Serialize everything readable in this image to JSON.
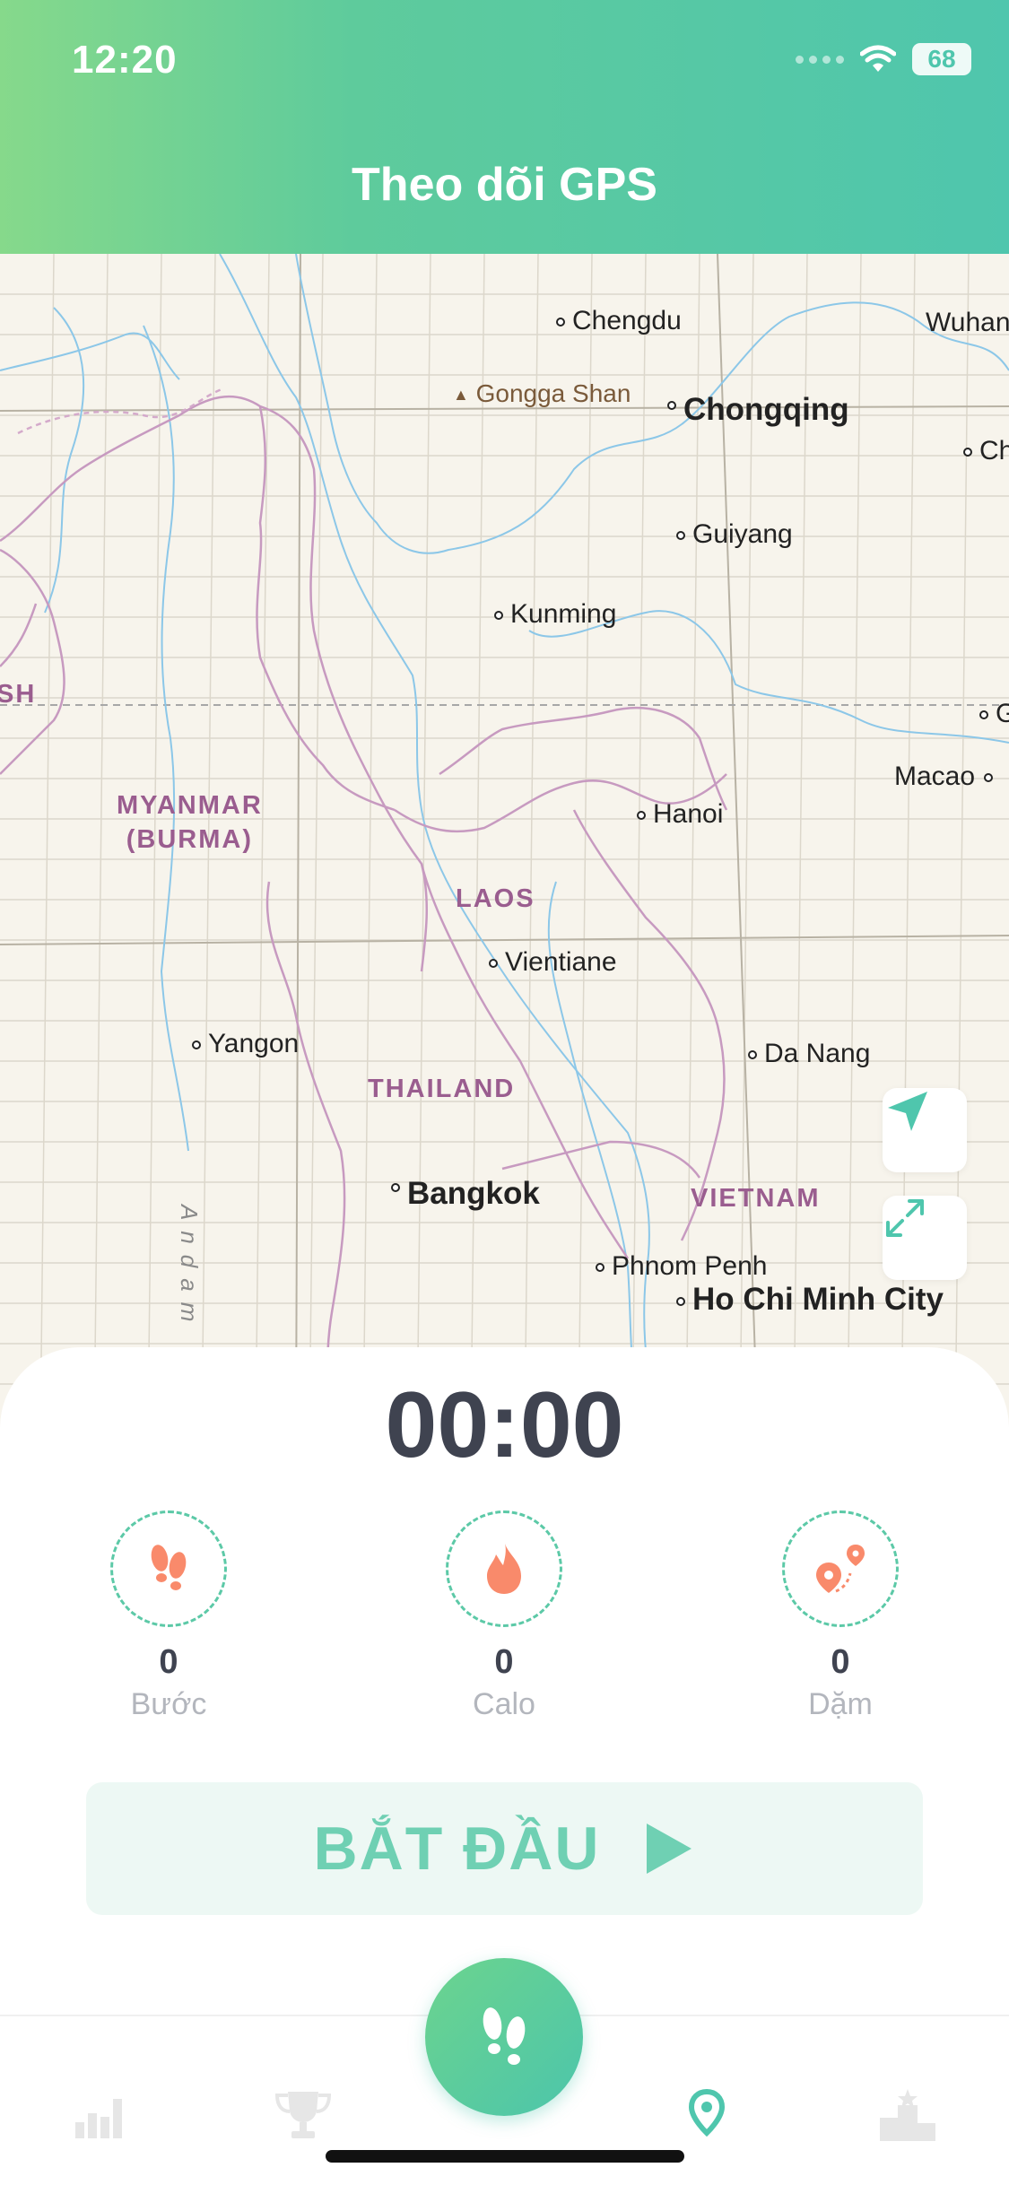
{
  "status_bar": {
    "time": "12:20",
    "battery": "68"
  },
  "header": {
    "title": "Theo dõi GPS"
  },
  "map": {
    "cities": {
      "chengdu": "Chengdu",
      "wuhan": "Wuhan",
      "chongqing": "Chongqing",
      "ch": "Ch",
      "guiyang": "Guiyang",
      "kunming": "Kunming",
      "hanoi": "Hanoi",
      "macao": "Macao",
      "g": "G",
      "vientiane": "Vientiane",
      "yangon": "Yangon",
      "da_nang": "Da Nang",
      "bangkok": "Bangkok",
      "phnom_penh": "Phnom Penh",
      "ho_chi_minh": "Ho Chi Minh City"
    },
    "peak": "Gongga Shan",
    "countries": {
      "myanmar": "MYANMAR\n(BURMA)",
      "laos": "LAOS",
      "thailand": "THAILAND",
      "vietnam": "VIETNAM",
      "sh": "SH"
    },
    "sea_label": "Andam"
  },
  "tracker": {
    "timer": "00:00",
    "stats": [
      {
        "value": "0",
        "label": "Bước",
        "icon": "footprints-icon"
      },
      {
        "value": "0",
        "label": "Calo",
        "icon": "flame-icon"
      },
      {
        "value": "0",
        "label": "Dặm",
        "icon": "route-pin-icon"
      }
    ],
    "start_label": "BẮT ĐẦU"
  },
  "colors": {
    "accent": "#4fc6ad",
    "stat_icon": "#f98a6b",
    "country_label": "#9a5d8f"
  }
}
